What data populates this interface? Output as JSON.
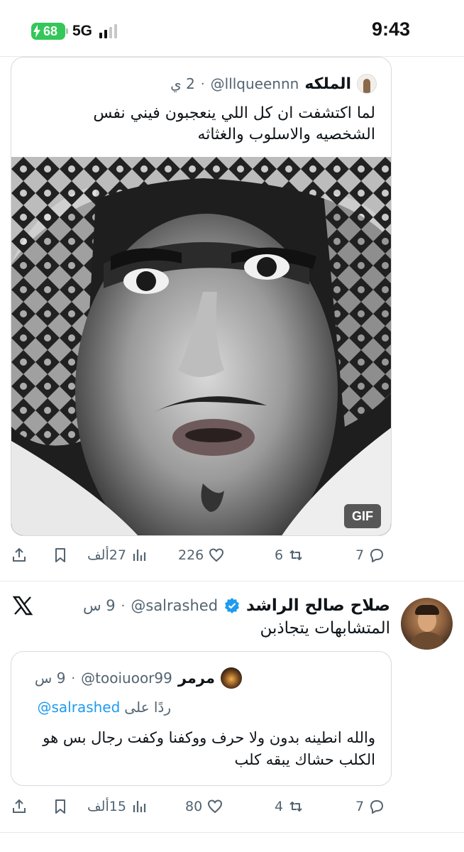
{
  "status_bar": {
    "battery": "68",
    "network": "5G",
    "time": "9:43",
    "battery_color": "#34c759"
  },
  "quote1": {
    "avatar_icon": "user-avatar",
    "name": "الملكه",
    "handle": "@lllqueennn",
    "time": "2 ي",
    "text": "لما اكتشفت ان كل اللي ينعجبون فيني نفس الشخصيه والاسلوب والغثاثه",
    "media_badge": "GIF"
  },
  "actions1": {
    "reply_count": "7",
    "retweet_count": "6",
    "like_count": "226",
    "views_count": "27ألف"
  },
  "tweet2": {
    "platform_icon": "x-logo",
    "name": "صلاح صالح الراشد",
    "verified": true,
    "handle": "@salrashed",
    "time": "9 س",
    "text": "المتشابهات يتجاذبن",
    "quote": {
      "name": "مرمر",
      "handle": "@tooiuoor99",
      "time": "9 س",
      "reply_label": "ردًا على",
      "reply_handle": "@salrashed",
      "text": "والله انطينه بدون ولا حرف ووكفنا وكفت رجال  بس هو الكلب حشاك يبقه كلب"
    }
  },
  "actions2": {
    "reply_count": "7",
    "retweet_count": "4",
    "like_count": "80",
    "views_count": "15ألف"
  },
  "colors": {
    "text_primary": "#0f1419",
    "text_secondary": "#536471",
    "link": "#1d9bf0",
    "verified": "#1d9bf0",
    "border": "#d6dbdf"
  }
}
